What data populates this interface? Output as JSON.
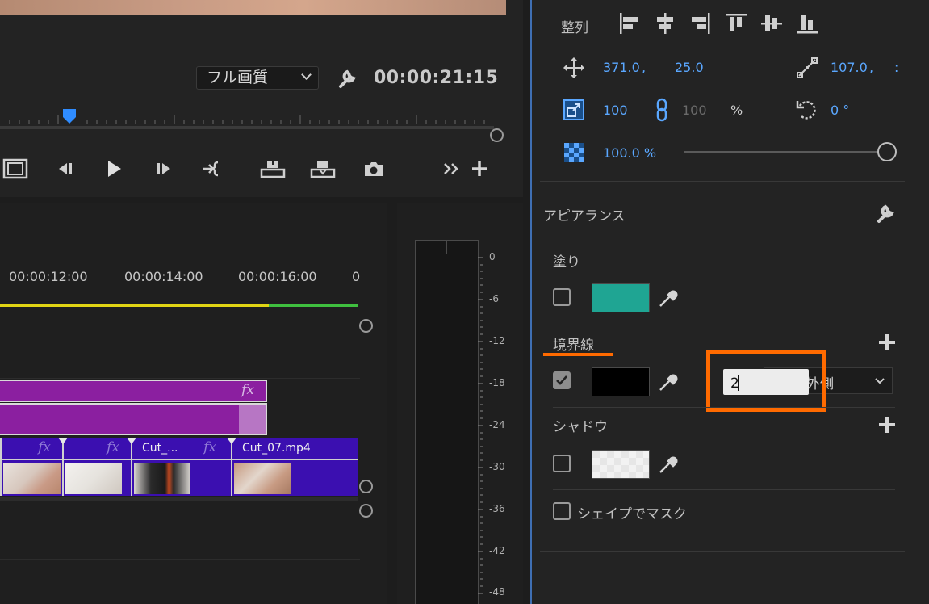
{
  "monitor": {
    "quality": "フル画質",
    "timecode": "00:00:21:15"
  },
  "timeline": {
    "times": [
      "00:00:12:00",
      "00:00:14:00",
      "00:00:16:00",
      "0"
    ],
    "clips": [
      {
        "name": "Cut_..."
      },
      {
        "name": "Cut_07.mp4"
      }
    ],
    "fx_label": "fx"
  },
  "audio_meter": {
    "scale": [
      "0",
      "-6",
      "-12",
      "-18",
      "-24",
      "-30",
      "-36",
      "-42",
      "-48"
    ]
  },
  "panel": {
    "align_label": "整列",
    "position": {
      "x": "371.0",
      "sep": ",",
      "y": "25.0"
    },
    "scale_value": "107.0",
    "scale_sep": ",",
    "scale_w": "100",
    "scale_h": "100",
    "percent": "%",
    "rotation": "0 °",
    "opacity": "100.0 %",
    "opacity_level": 1.0,
    "appearance_label": "アピアランス",
    "fill": {
      "label": "塗り",
      "checked": false,
      "color": "#1fa593"
    },
    "stroke": {
      "label": "境界線",
      "checked": true,
      "color": "#000000",
      "width_value": "2",
      "position": "外側"
    },
    "shadow": {
      "label": "シャドウ",
      "checked": false,
      "color": "#e6e6e6"
    },
    "shape_mask_label": "シェイプでマスク"
  },
  "highlights": {
    "accent": "#ff6a00"
  }
}
